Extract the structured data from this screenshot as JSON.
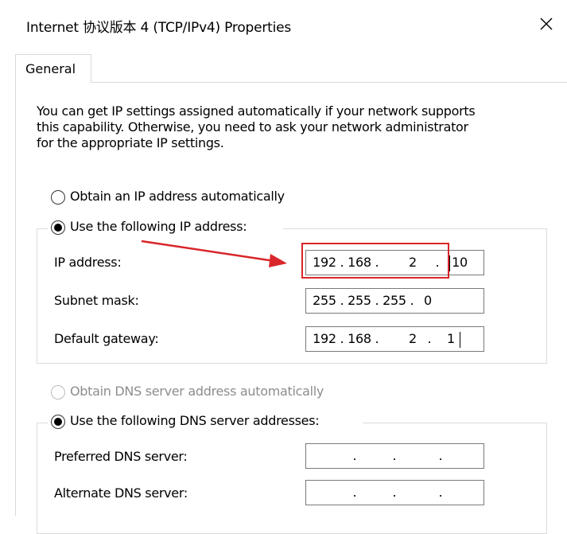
{
  "window": {
    "title": "Internet 协议版本 4 (TCP/IPv4) Properties",
    "close_icon": "close-icon"
  },
  "tabs": [
    {
      "label": "General",
      "selected": true
    }
  ],
  "general": {
    "description_lines": [
      "You can get IP settings assigned automatically if your network supports",
      "this capability. Otherwise, you need to ask your network administrator",
      "for the appropriate IP settings."
    ],
    "ip_mode": {
      "auto_label": "Obtain an IP address automatically",
      "manual_label": "Use the following IP address:",
      "selected": "manual"
    },
    "ip_fields": {
      "ip_address": {
        "label": "IP address:",
        "octets": [
          "192",
          "168",
          "2",
          "10"
        ]
      },
      "subnet_mask": {
        "label": "Subnet mask:",
        "octets": [
          "255",
          "255",
          "255",
          "0"
        ]
      },
      "default_gateway": {
        "label": "Default gateway:",
        "octets": [
          "192",
          "168",
          "2",
          "1"
        ]
      }
    },
    "dns_mode": {
      "auto_label": "Obtain DNS server address automatically",
      "auto_disabled": true,
      "manual_label": "Use the following DNS server addresses:",
      "selected": "manual"
    },
    "dns_fields": {
      "preferred": {
        "label": "Preferred DNS server:",
        "octets": [
          "",
          "",
          "",
          ""
        ]
      },
      "alternate": {
        "label": "Alternate DNS server:",
        "octets": [
          "",
          "",
          "",
          ""
        ]
      }
    }
  },
  "annotation": {
    "color": "#d9262a"
  }
}
